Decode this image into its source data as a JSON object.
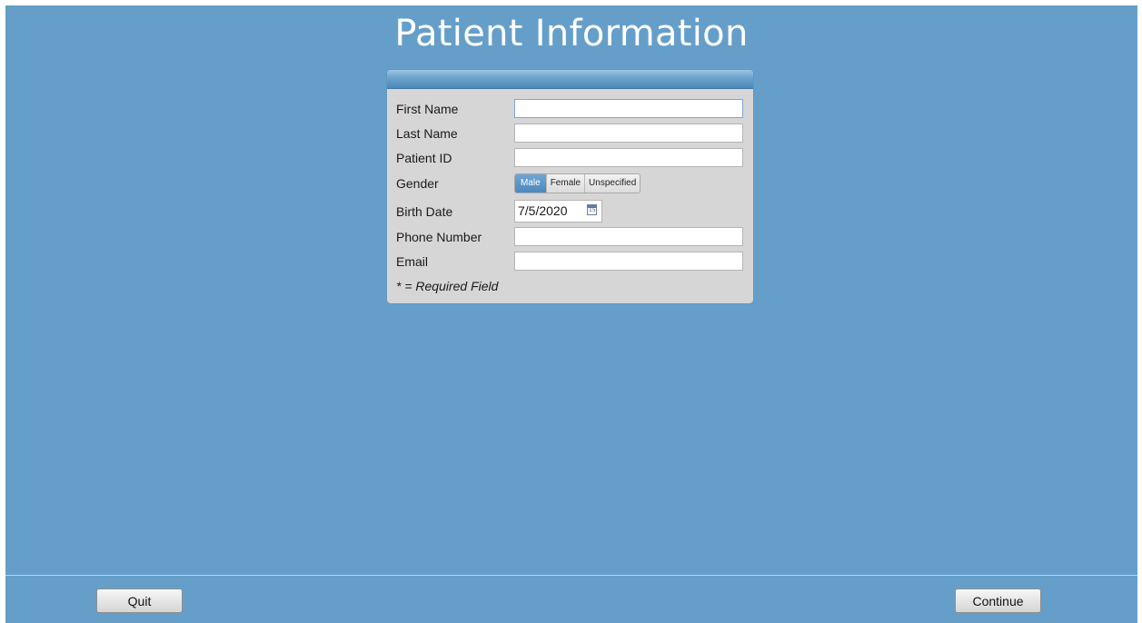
{
  "title": "Patient Information",
  "form": {
    "first_name": {
      "label": "First Name",
      "value": ""
    },
    "last_name": {
      "label": "Last Name",
      "value": ""
    },
    "patient_id": {
      "label": "Patient ID",
      "value": ""
    },
    "gender": {
      "label": "Gender",
      "options": [
        "Male",
        "Female",
        "Unspecified"
      ],
      "selected": "Male"
    },
    "birth_date": {
      "label": "Birth Date",
      "value": "7/5/2020",
      "icon": "calendar-icon"
    },
    "phone": {
      "label": "Phone Number",
      "value": ""
    },
    "email": {
      "label": "Email",
      "value": ""
    },
    "required_note": "* = Required Field"
  },
  "footer": {
    "quit_label": "Quit",
    "continue_label": "Continue"
  },
  "colors": {
    "background": "#659fc9",
    "panel": "#d6d6d6",
    "selected_segment": "#4d87bd"
  }
}
